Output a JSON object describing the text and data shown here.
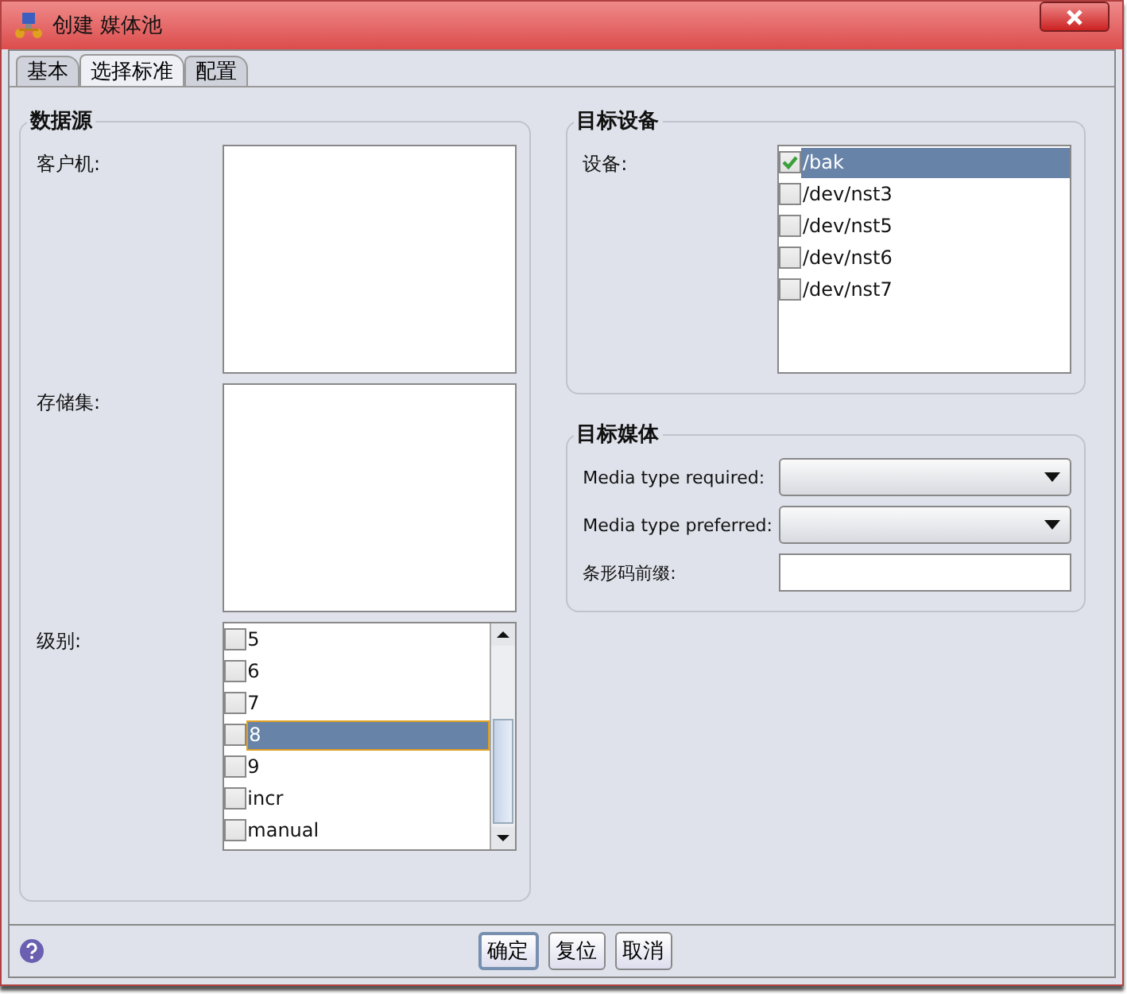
{
  "window": {
    "title": "创建 媒体池"
  },
  "tabs": [
    {
      "label": "基本",
      "selected": false
    },
    {
      "label": "选择标准",
      "selected": true
    },
    {
      "label": "配置",
      "selected": false
    }
  ],
  "data_source": {
    "title": "数据源",
    "client_label": "客户机:",
    "storage_label": "存储集:",
    "level_label": "级别:",
    "levels": [
      {
        "label": "5",
        "checked": false,
        "selected": false
      },
      {
        "label": "6",
        "checked": false,
        "selected": false
      },
      {
        "label": "7",
        "checked": false,
        "selected": false
      },
      {
        "label": "8",
        "checked": false,
        "selected": true
      },
      {
        "label": "9",
        "checked": false,
        "selected": false
      },
      {
        "label": "incr",
        "checked": false,
        "selected": false
      },
      {
        "label": "manual",
        "checked": false,
        "selected": false
      }
    ]
  },
  "target_devices": {
    "title": "目标设备",
    "device_label": "设备:",
    "devices": [
      {
        "label": "/bak",
        "checked": true,
        "selected": true
      },
      {
        "label": "/dev/nst3",
        "checked": false,
        "selected": false
      },
      {
        "label": "/dev/nst5",
        "checked": false,
        "selected": false
      },
      {
        "label": "/dev/nst6",
        "checked": false,
        "selected": false
      },
      {
        "label": "/dev/nst7",
        "checked": false,
        "selected": false
      }
    ]
  },
  "target_media": {
    "title": "目标媒体",
    "required_label": "Media type required:",
    "preferred_label": "Media type preferred:",
    "barcode_label": "条形码前缀:"
  },
  "buttons": [
    "确定",
    "复位",
    "取消"
  ]
}
